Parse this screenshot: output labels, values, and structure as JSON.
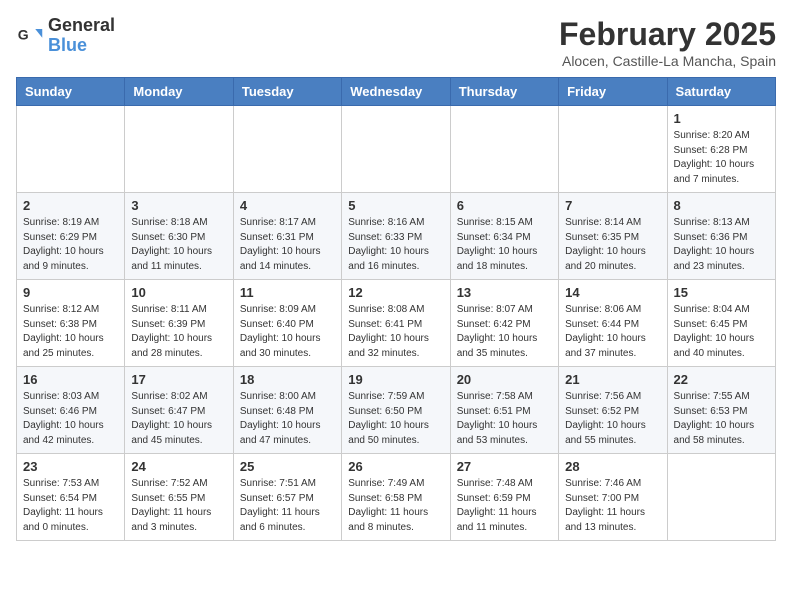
{
  "header": {
    "logo_general": "General",
    "logo_blue": "Blue",
    "month_title": "February 2025",
    "subtitle": "Alocen, Castille-La Mancha, Spain"
  },
  "days_of_week": [
    "Sunday",
    "Monday",
    "Tuesday",
    "Wednesday",
    "Thursday",
    "Friday",
    "Saturday"
  ],
  "weeks": [
    [
      {
        "day": "",
        "info": ""
      },
      {
        "day": "",
        "info": ""
      },
      {
        "day": "",
        "info": ""
      },
      {
        "day": "",
        "info": ""
      },
      {
        "day": "",
        "info": ""
      },
      {
        "day": "",
        "info": ""
      },
      {
        "day": "1",
        "info": "Sunrise: 8:20 AM\nSunset: 6:28 PM\nDaylight: 10 hours and 7 minutes."
      }
    ],
    [
      {
        "day": "2",
        "info": "Sunrise: 8:19 AM\nSunset: 6:29 PM\nDaylight: 10 hours and 9 minutes."
      },
      {
        "day": "3",
        "info": "Sunrise: 8:18 AM\nSunset: 6:30 PM\nDaylight: 10 hours and 11 minutes."
      },
      {
        "day": "4",
        "info": "Sunrise: 8:17 AM\nSunset: 6:31 PM\nDaylight: 10 hours and 14 minutes."
      },
      {
        "day": "5",
        "info": "Sunrise: 8:16 AM\nSunset: 6:33 PM\nDaylight: 10 hours and 16 minutes."
      },
      {
        "day": "6",
        "info": "Sunrise: 8:15 AM\nSunset: 6:34 PM\nDaylight: 10 hours and 18 minutes."
      },
      {
        "day": "7",
        "info": "Sunrise: 8:14 AM\nSunset: 6:35 PM\nDaylight: 10 hours and 20 minutes."
      },
      {
        "day": "8",
        "info": "Sunrise: 8:13 AM\nSunset: 6:36 PM\nDaylight: 10 hours and 23 minutes."
      }
    ],
    [
      {
        "day": "9",
        "info": "Sunrise: 8:12 AM\nSunset: 6:38 PM\nDaylight: 10 hours and 25 minutes."
      },
      {
        "day": "10",
        "info": "Sunrise: 8:11 AM\nSunset: 6:39 PM\nDaylight: 10 hours and 28 minutes."
      },
      {
        "day": "11",
        "info": "Sunrise: 8:09 AM\nSunset: 6:40 PM\nDaylight: 10 hours and 30 minutes."
      },
      {
        "day": "12",
        "info": "Sunrise: 8:08 AM\nSunset: 6:41 PM\nDaylight: 10 hours and 32 minutes."
      },
      {
        "day": "13",
        "info": "Sunrise: 8:07 AM\nSunset: 6:42 PM\nDaylight: 10 hours and 35 minutes."
      },
      {
        "day": "14",
        "info": "Sunrise: 8:06 AM\nSunset: 6:44 PM\nDaylight: 10 hours and 37 minutes."
      },
      {
        "day": "15",
        "info": "Sunrise: 8:04 AM\nSunset: 6:45 PM\nDaylight: 10 hours and 40 minutes."
      }
    ],
    [
      {
        "day": "16",
        "info": "Sunrise: 8:03 AM\nSunset: 6:46 PM\nDaylight: 10 hours and 42 minutes."
      },
      {
        "day": "17",
        "info": "Sunrise: 8:02 AM\nSunset: 6:47 PM\nDaylight: 10 hours and 45 minutes."
      },
      {
        "day": "18",
        "info": "Sunrise: 8:00 AM\nSunset: 6:48 PM\nDaylight: 10 hours and 47 minutes."
      },
      {
        "day": "19",
        "info": "Sunrise: 7:59 AM\nSunset: 6:50 PM\nDaylight: 10 hours and 50 minutes."
      },
      {
        "day": "20",
        "info": "Sunrise: 7:58 AM\nSunset: 6:51 PM\nDaylight: 10 hours and 53 minutes."
      },
      {
        "day": "21",
        "info": "Sunrise: 7:56 AM\nSunset: 6:52 PM\nDaylight: 10 hours and 55 minutes."
      },
      {
        "day": "22",
        "info": "Sunrise: 7:55 AM\nSunset: 6:53 PM\nDaylight: 10 hours and 58 minutes."
      }
    ],
    [
      {
        "day": "23",
        "info": "Sunrise: 7:53 AM\nSunset: 6:54 PM\nDaylight: 11 hours and 0 minutes."
      },
      {
        "day": "24",
        "info": "Sunrise: 7:52 AM\nSunset: 6:55 PM\nDaylight: 11 hours and 3 minutes."
      },
      {
        "day": "25",
        "info": "Sunrise: 7:51 AM\nSunset: 6:57 PM\nDaylight: 11 hours and 6 minutes."
      },
      {
        "day": "26",
        "info": "Sunrise: 7:49 AM\nSunset: 6:58 PM\nDaylight: 11 hours and 8 minutes."
      },
      {
        "day": "27",
        "info": "Sunrise: 7:48 AM\nSunset: 6:59 PM\nDaylight: 11 hours and 11 minutes."
      },
      {
        "day": "28",
        "info": "Sunrise: 7:46 AM\nSunset: 7:00 PM\nDaylight: 11 hours and 13 minutes."
      },
      {
        "day": "",
        "info": ""
      }
    ]
  ]
}
